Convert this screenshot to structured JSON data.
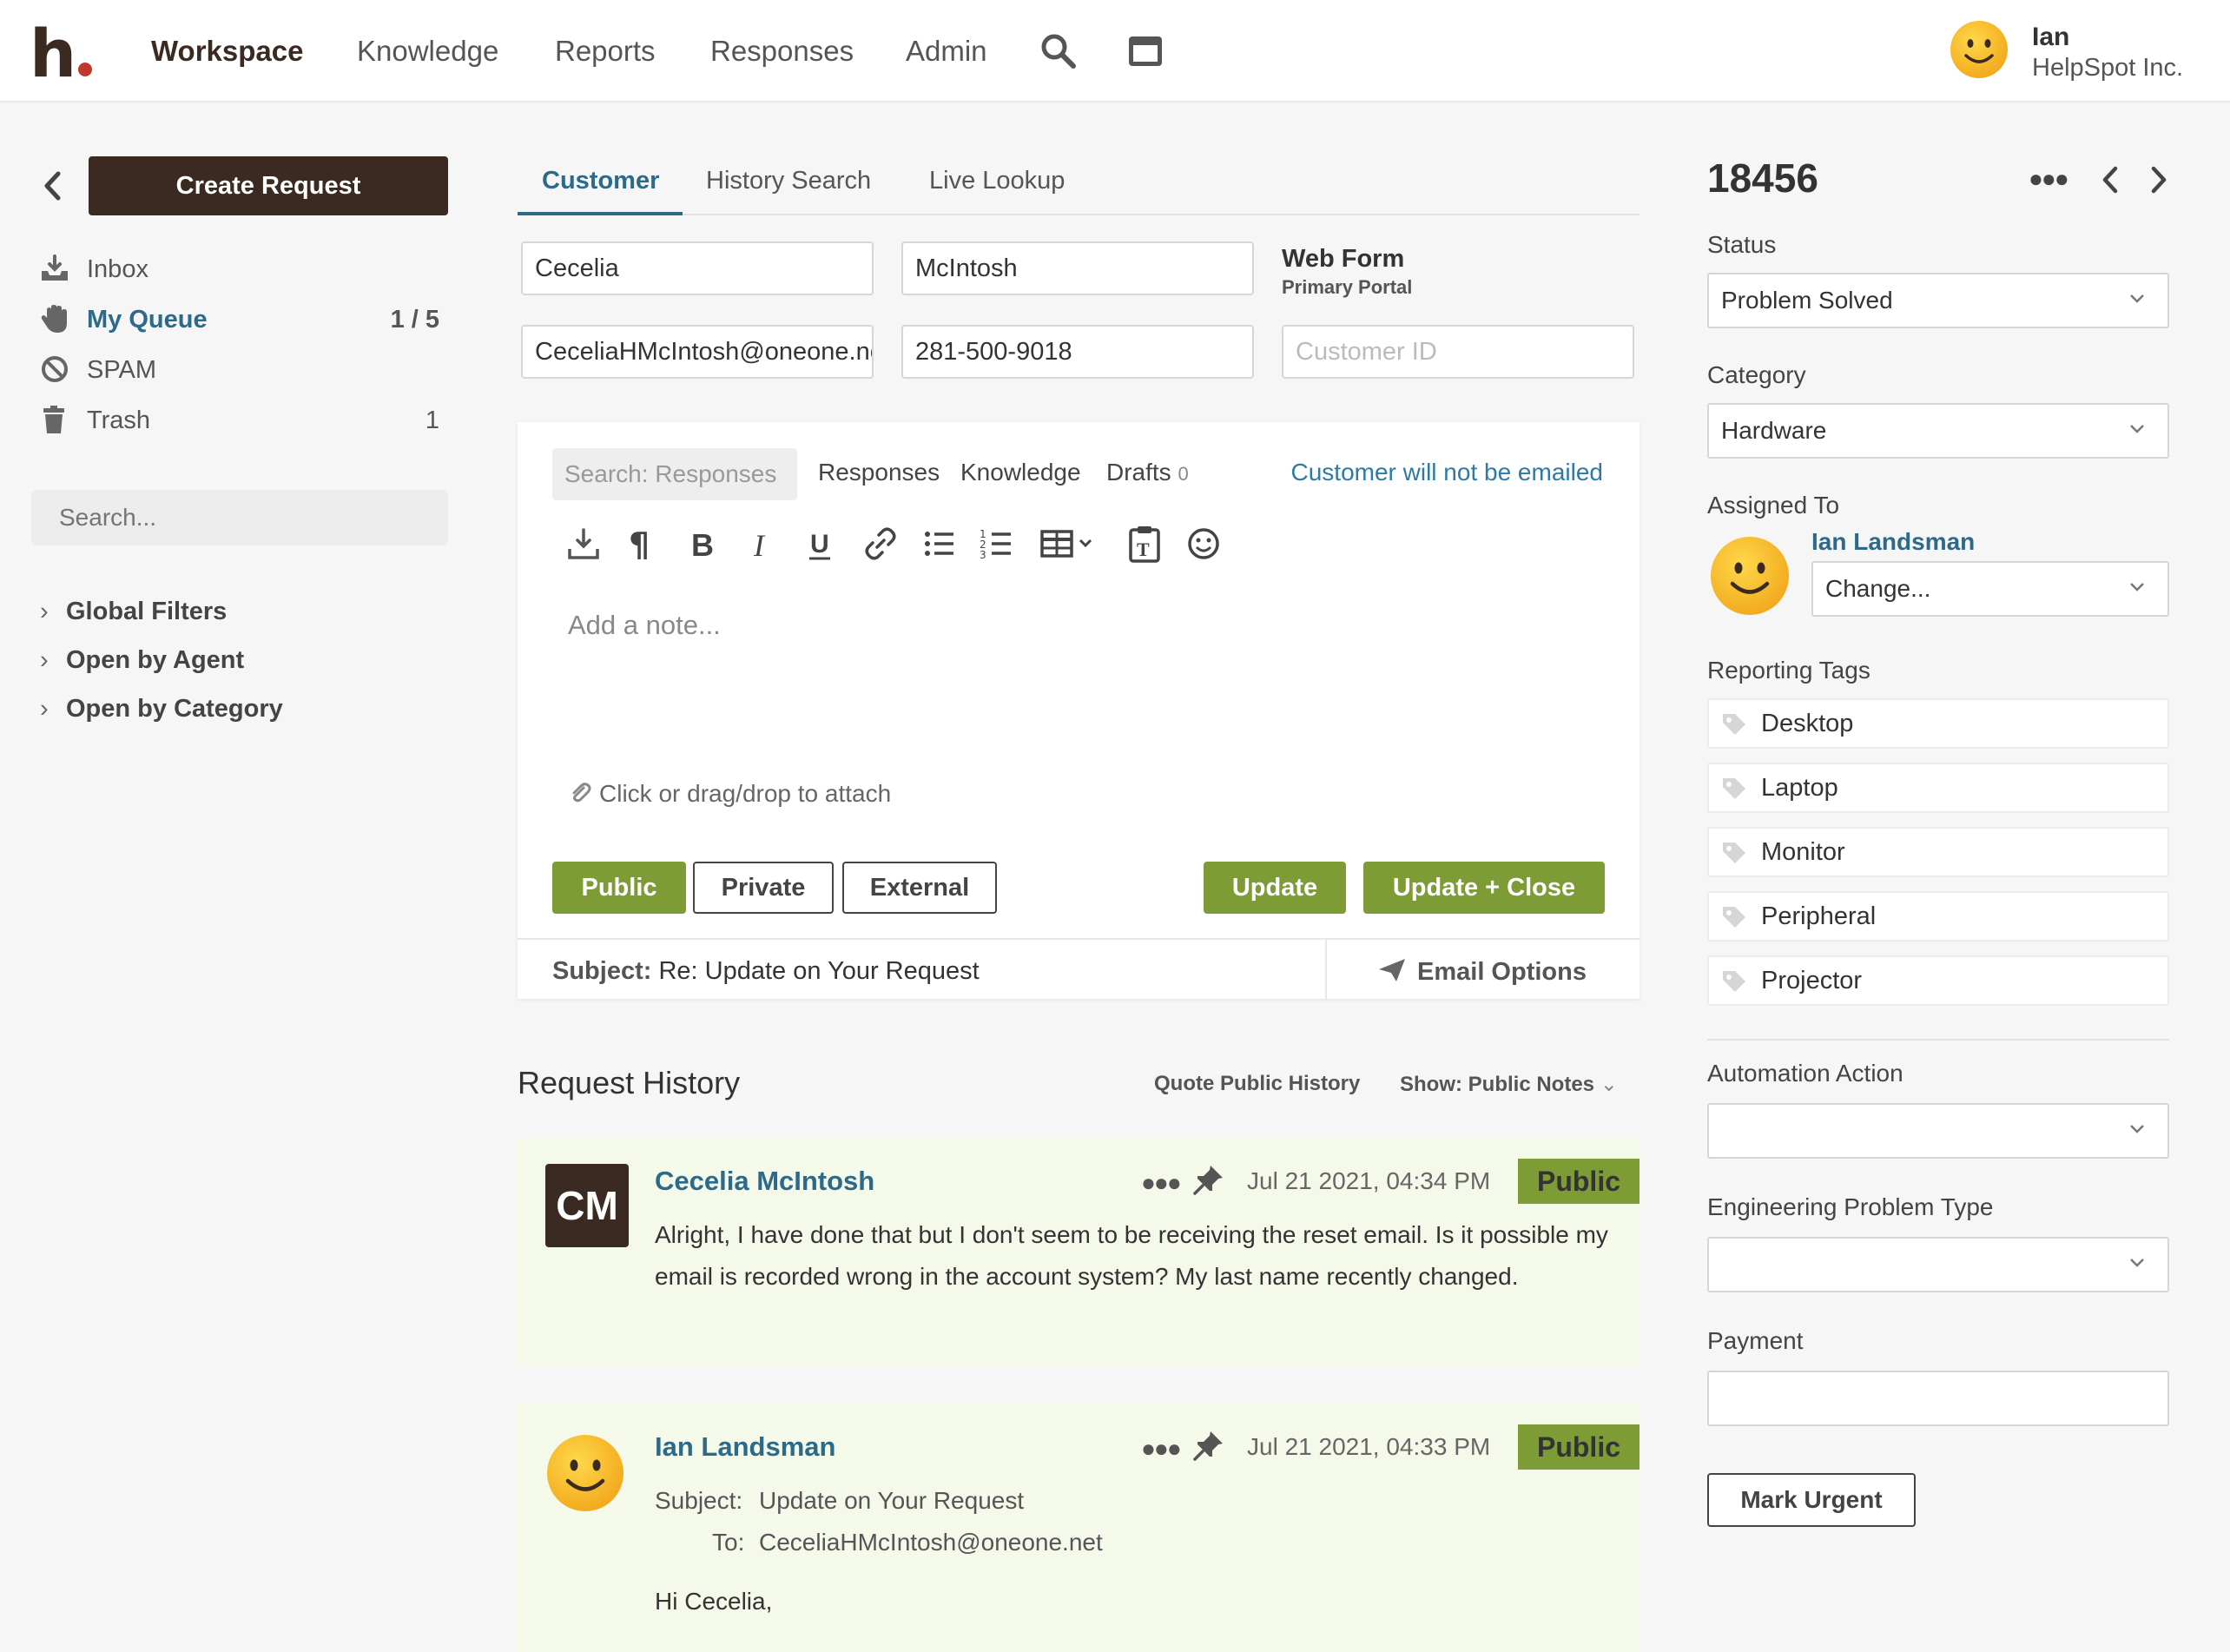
{
  "nav": {
    "logo_letter": "h",
    "items": [
      "Workspace",
      "Knowledge",
      "Reports",
      "Responses",
      "Admin"
    ],
    "icons": [
      "search-icon",
      "inbox-window-icon"
    ],
    "user": {
      "name": "Ian",
      "org": "HelpSpot Inc.",
      "avatar_icon": "smiley-avatar-icon"
    }
  },
  "sidebar": {
    "create_label": "Create Request",
    "items": [
      {
        "label": "Inbox",
        "icon": "inbox-tray-icon",
        "count": ""
      },
      {
        "label": "My Queue",
        "icon": "hand-icon",
        "count": "1 / 5"
      },
      {
        "label": "SPAM",
        "icon": "prohibited-icon",
        "count": ""
      },
      {
        "label": "Trash",
        "icon": "trash-icon",
        "count": "1"
      }
    ],
    "search_placeholder": "Search...",
    "filters": [
      "Global Filters",
      "Open by Agent",
      "Open by Category"
    ]
  },
  "customer": {
    "tabs": [
      "Customer",
      "History Search",
      "Live Lookup"
    ],
    "first_name": "Cecelia",
    "last_name": "McIntosh",
    "email": "CeceliaHMcIntosh@oneone.net",
    "phone": "281-500-9018",
    "customer_id_placeholder": "Customer ID",
    "source_title": "Web Form",
    "source_sub": "Primary Portal"
  },
  "editor": {
    "search_placeholder": "Search: Responses",
    "links": [
      "Responses",
      "Knowledge",
      "Drafts"
    ],
    "drafts_count": "0",
    "notify": "Customer will not be emailed",
    "note_placeholder": "Add a note...",
    "attach_text": "Click or drag/drop to attach",
    "buttons": {
      "public": "Public",
      "private": "Private",
      "external": "External",
      "update": "Update",
      "update_close": "Update + Close"
    },
    "subject_label": "Subject:",
    "subject_value": "Re: Update on Your Request",
    "email_options": "Email Options"
  },
  "history": {
    "title": "Request History",
    "quote": "Quote Public History",
    "show": "Show: Public Notes",
    "notes": [
      {
        "author": "Cecelia McIntosh",
        "initials": "CM",
        "date": "Jul 21 2021, 04:34 PM",
        "badge": "Public",
        "body": "Alright, I have done that but I don't seem to be receiving the reset email. Is it possible my email is recorded wrong in the account system? My last name recently changed."
      },
      {
        "author": "Ian Landsman",
        "date": "Jul 21 2021, 04:33 PM",
        "badge": "Public",
        "subject_label": "Subject:",
        "subject_value": "Update on Your Request",
        "to_label": "To:",
        "to_value": "CeceliaHMcIntosh@oneone.net",
        "body": "Hi Cecelia,"
      }
    ]
  },
  "details": {
    "request_id": "18456",
    "status_label": "Status",
    "status_value": "Problem Solved",
    "category_label": "Category",
    "category_value": "Hardware",
    "assigned_label": "Assigned To",
    "assigned_name": "Ian Landsman",
    "assigned_select": "Change...",
    "tags_label": "Reporting Tags",
    "tags": [
      "Desktop",
      "Laptop",
      "Monitor",
      "Peripheral",
      "Projector"
    ],
    "automation_label": "Automation Action",
    "engineering_label": "Engineering Problem Type",
    "payment_label": "Payment",
    "urgent_label": "Mark Urgent"
  },
  "colors": {
    "brand_dark": "#3a2a21",
    "accent_blue": "#2d6a8a",
    "green": "#7d9c35",
    "note_bg": "#f4f9ea"
  }
}
